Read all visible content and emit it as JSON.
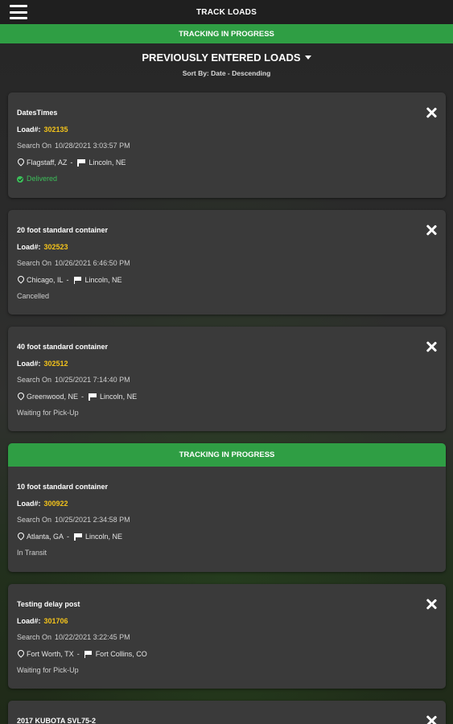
{
  "header": {
    "title": "TRACK LOADS",
    "menu_icon": "hamburger-menu-icon"
  },
  "tracking_banner": "TRACKING IN PROGRESS",
  "section": {
    "title": "PREVIOUSLY ENTERED LOADS",
    "sort_label": "Sort By: Date - Descending"
  },
  "colors": {
    "accent_green": "#2f9e44",
    "load_number": "#f2c21b",
    "delivered": "#3cbf5a",
    "card_bg": "#3a3a3a"
  },
  "loads": [
    {
      "description": "DatesTimes",
      "load_label": "Load#:",
      "load_number": "302135",
      "search_label": "Search On",
      "search_datetime": "10/28/2021 3:03:57 PM",
      "origin": "Flagstaff, AZ",
      "separator": "-",
      "destination": "Lincoln, NE",
      "status": "Delivered"
    },
    {
      "description": "20 foot standard container",
      "load_label": "Load#:",
      "load_number": "302523",
      "search_label": "Search On",
      "search_datetime": "10/26/2021 6:46:50 PM",
      "origin": "Chicago, IL",
      "separator": "-",
      "destination": "Lincoln, NE",
      "status": "Cancelled"
    },
    {
      "description": "40 foot standard container",
      "load_label": "Load#:",
      "load_number": "302512",
      "search_label": "Search On",
      "search_datetime": "10/25/2021 7:14:40 PM",
      "origin": "Greenwood, NE",
      "separator": "-",
      "destination": "Lincoln, NE",
      "status": "Waiting for Pick-Up"
    },
    {
      "banner": "TRACKING IN PROGRESS",
      "description": "10 foot standard container",
      "load_label": "Load#:",
      "load_number": "300922",
      "search_label": "Search On",
      "search_datetime": "10/25/2021 2:34:58 PM",
      "origin": "Atlanta, GA",
      "separator": "-",
      "destination": "Lincoln, NE",
      "status": "In Transit"
    },
    {
      "description": "Testing delay post",
      "load_label": "Load#:",
      "load_number": "301706",
      "search_label": "Search On",
      "search_datetime": "10/22/2021 3:22:45 PM",
      "origin": "Fort Worth, TX",
      "separator": "-",
      "destination": "Fort Collins, CO",
      "status": "Waiting for Pick-Up"
    },
    {
      "description": "2017 KUBOTA SVL75-2"
    }
  ]
}
